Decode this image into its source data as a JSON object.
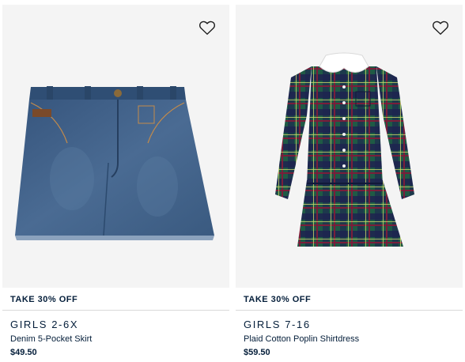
{
  "products": [
    {
      "promo": "TAKE 30% OFF",
      "category": "GIRLS 2-6X",
      "name": "Denim 5-Pocket Skirt",
      "price": "$49.50",
      "image": "denim-skirt-image",
      "favorite_icon": "heart-outline-icon"
    },
    {
      "promo": "TAKE 30% OFF",
      "category": "GIRLS 7-16",
      "name": "Plaid Cotton Poplin Shirtdress",
      "price": "$59.50",
      "image": "plaid-shirtdress-image",
      "favorite_icon": "heart-outline-icon"
    }
  ],
  "colors": {
    "text": "#041e3a",
    "image_bg": "#f4f4f4",
    "divider": "#d9d9d9",
    "denim": "#3f5f85",
    "plaid_green": "#1f5a45",
    "plaid_navy": "#1d2350"
  }
}
